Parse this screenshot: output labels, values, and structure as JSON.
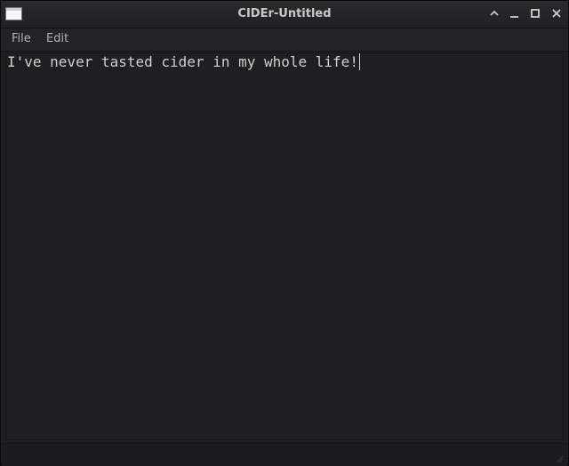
{
  "window": {
    "title": "CIDEr-Untitled",
    "controls": [
      "shade",
      "minimize",
      "maximize",
      "close"
    ]
  },
  "menubar": {
    "items": [
      "File",
      "Edit"
    ]
  },
  "editor": {
    "content": "I've never tasted cider in my whole life!"
  },
  "colors": {
    "window_bg": "#1e1f21",
    "title_text": "#c9c9c9",
    "menu_text": "#b4b4b4",
    "editor_text": "#cfcfcf"
  }
}
